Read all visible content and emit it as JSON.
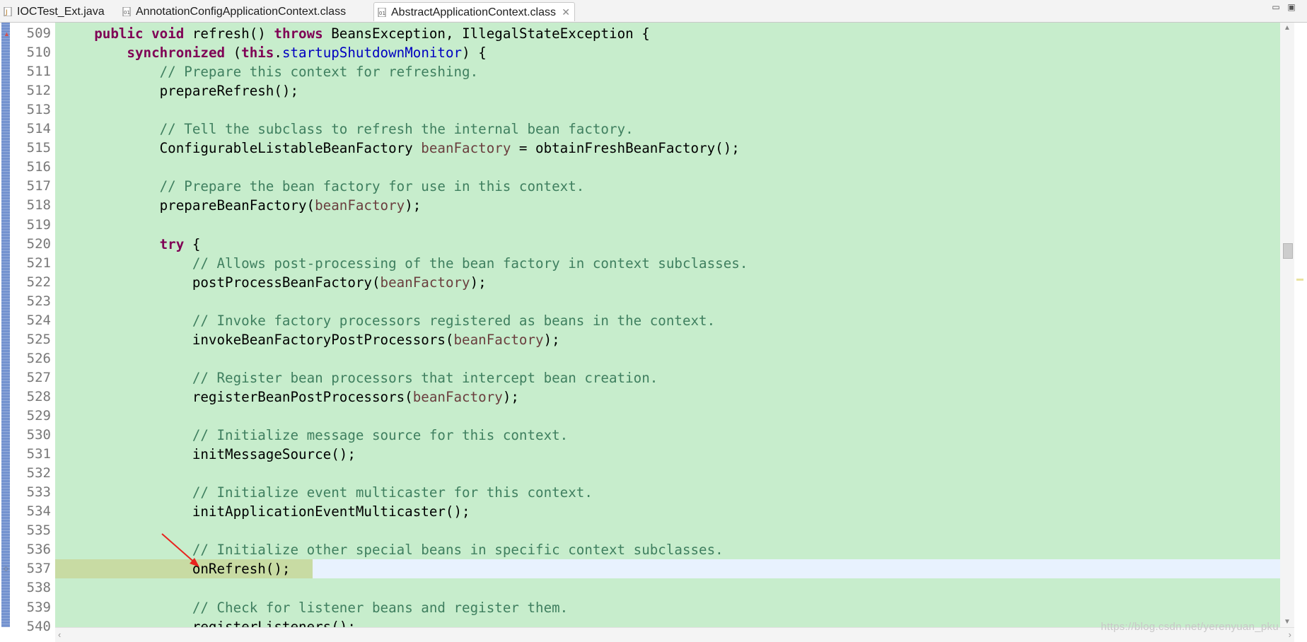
{
  "tabs": [
    {
      "label": "IOCTest_Ext.java",
      "icon": "java-file-icon",
      "active": false
    },
    {
      "label": "AnnotationConfigApplicationContext.class",
      "icon": "class-file-icon",
      "active": false
    },
    {
      "label": "AbstractApplicationContext.class",
      "icon": "class-file-icon",
      "active": true
    }
  ],
  "tab_close_glyph": "✕",
  "window_controls": {
    "minimize": "▭",
    "maximize": "▣"
  },
  "code_lines": [
    {
      "num": "509",
      "tokens": [
        {
          "t": "    "
        },
        {
          "t": "public",
          "c": "kw"
        },
        {
          "t": " "
        },
        {
          "t": "void",
          "c": "kw"
        },
        {
          "t": " refresh() "
        },
        {
          "t": "throws",
          "c": "kw"
        },
        {
          "t": " BeansException, IllegalStateException {"
        }
      ]
    },
    {
      "num": "510",
      "tokens": [
        {
          "t": "        "
        },
        {
          "t": "synchronized",
          "c": "kw"
        },
        {
          "t": " ("
        },
        {
          "t": "this",
          "c": "kw"
        },
        {
          "t": "."
        },
        {
          "t": "startupShutdownMonitor",
          "c": "fld"
        },
        {
          "t": ") {"
        }
      ]
    },
    {
      "num": "511",
      "tokens": [
        {
          "t": "            "
        },
        {
          "t": "// Prepare this context for refreshing.",
          "c": "cm"
        }
      ]
    },
    {
      "num": "512",
      "tokens": [
        {
          "t": "            prepareRefresh();"
        }
      ]
    },
    {
      "num": "513",
      "tokens": []
    },
    {
      "num": "514",
      "tokens": [
        {
          "t": "            "
        },
        {
          "t": "// Tell the subclass to refresh the internal bean factory.",
          "c": "cm"
        }
      ]
    },
    {
      "num": "515",
      "tokens": [
        {
          "t": "            ConfigurableListableBeanFactory "
        },
        {
          "t": "beanFactory",
          "c": "var"
        },
        {
          "t": " = obtainFreshBeanFactory();"
        }
      ]
    },
    {
      "num": "516",
      "tokens": []
    },
    {
      "num": "517",
      "tokens": [
        {
          "t": "            "
        },
        {
          "t": "// Prepare the bean factory for use in this context.",
          "c": "cm"
        }
      ]
    },
    {
      "num": "518",
      "tokens": [
        {
          "t": "            prepareBeanFactory("
        },
        {
          "t": "beanFactory",
          "c": "var"
        },
        {
          "t": ");"
        }
      ]
    },
    {
      "num": "519",
      "tokens": []
    },
    {
      "num": "520",
      "tokens": [
        {
          "t": "            "
        },
        {
          "t": "try",
          "c": "kw"
        },
        {
          "t": " {"
        }
      ]
    },
    {
      "num": "521",
      "tokens": [
        {
          "t": "                "
        },
        {
          "t": "// Allows post-processing of the bean factory in context subclasses.",
          "c": "cm"
        }
      ]
    },
    {
      "num": "522",
      "tokens": [
        {
          "t": "                postProcessBeanFactory("
        },
        {
          "t": "beanFactory",
          "c": "var"
        },
        {
          "t": ");"
        }
      ]
    },
    {
      "num": "523",
      "tokens": []
    },
    {
      "num": "524",
      "tokens": [
        {
          "t": "                "
        },
        {
          "t": "// Invoke factory processors registered as beans in the context.",
          "c": "cm"
        }
      ]
    },
    {
      "num": "525",
      "tokens": [
        {
          "t": "                invokeBeanFactoryPostProcessors("
        },
        {
          "t": "beanFactory",
          "c": "var"
        },
        {
          "t": ");"
        }
      ]
    },
    {
      "num": "526",
      "tokens": []
    },
    {
      "num": "527",
      "tokens": [
        {
          "t": "                "
        },
        {
          "t": "// Register bean processors that intercept bean creation.",
          "c": "cm"
        }
      ]
    },
    {
      "num": "528",
      "tokens": [
        {
          "t": "                registerBeanPostProcessors("
        },
        {
          "t": "beanFactory",
          "c": "var"
        },
        {
          "t": ");"
        }
      ]
    },
    {
      "num": "529",
      "tokens": []
    },
    {
      "num": "530",
      "tokens": [
        {
          "t": "                "
        },
        {
          "t": "// Initialize message source for this context.",
          "c": "cm"
        }
      ]
    },
    {
      "num": "531",
      "tokens": [
        {
          "t": "                initMessageSource();"
        }
      ]
    },
    {
      "num": "532",
      "tokens": []
    },
    {
      "num": "533",
      "tokens": [
        {
          "t": "                "
        },
        {
          "t": "// Initialize event multicaster for this context.",
          "c": "cm"
        }
      ]
    },
    {
      "num": "534",
      "tokens": [
        {
          "t": "                initApplicationEventMulticaster();"
        }
      ]
    },
    {
      "num": "535",
      "tokens": []
    },
    {
      "num": "536",
      "tokens": [
        {
          "t": "                "
        },
        {
          "t": "// Initialize other special beans in specific context subclasses.",
          "c": "cm"
        }
      ]
    },
    {
      "num": "537",
      "tokens": [
        {
          "t": "                onRefresh();"
        }
      ],
      "current": true
    },
    {
      "num": "538",
      "tokens": []
    },
    {
      "num": "539",
      "tokens": [
        {
          "t": "                "
        },
        {
          "t": "// Check for listener beans and register them.",
          "c": "cm"
        }
      ]
    },
    {
      "num": "540",
      "tokens": [
        {
          "t": "                registerListeners();"
        }
      ]
    }
  ],
  "watermark": "https://blog.csdn.net/yerenyuan_pku",
  "colors": {
    "code_background": "#c7edcc",
    "keyword": "#7f0055",
    "comment": "#3f7f5f",
    "field": "#0000c0",
    "local_variable": "#6a3e3e",
    "current_line": "#e8f2fe",
    "annotation_arrow": "#e8231e"
  }
}
